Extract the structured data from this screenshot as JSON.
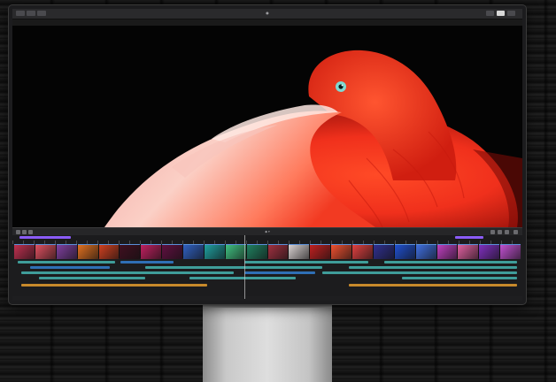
{
  "app": {
    "window_title": "●",
    "viewer_left_label": "",
    "viewer_right_label": "",
    "timeline_title": "◆ ▾"
  },
  "colors": {
    "accent_purple": "#8b5cf6",
    "clip_teal": "#3f9d9a",
    "clip_blue": "#2f6fb5",
    "audio_orange": "#c8892b",
    "flamingo_red": "#f0301c",
    "flamingo_pink": "#f7b6b0"
  },
  "icons": {
    "toolbar_left": [
      "library-icon",
      "media-icon",
      "layout-icon"
    ],
    "toolbar_right": [
      "viewer-layout-icon",
      "inspector-icon",
      "share-icon"
    ],
    "timeline_controls": [
      "back-icon",
      "forward-icon",
      "tools-icon"
    ]
  },
  "viewer_image": {
    "subject": "flamingo"
  },
  "timeline": {
    "filmstrip_colors": [
      "#c03050",
      "#e05060",
      "#8040a0",
      "#e07020",
      "#d04020",
      "#401020",
      "#c02060",
      "#601040",
      "#3060c0",
      "#20a0a0",
      "#40c080",
      "#208060",
      "#a03040",
      "#d8d0d0",
      "#c02020",
      "#f05030",
      "#e04040",
      "#303090",
      "#2050d0",
      "#4070e0",
      "#c040c0",
      "#e060a0",
      "#8030c0",
      "#c050d0"
    ]
  }
}
